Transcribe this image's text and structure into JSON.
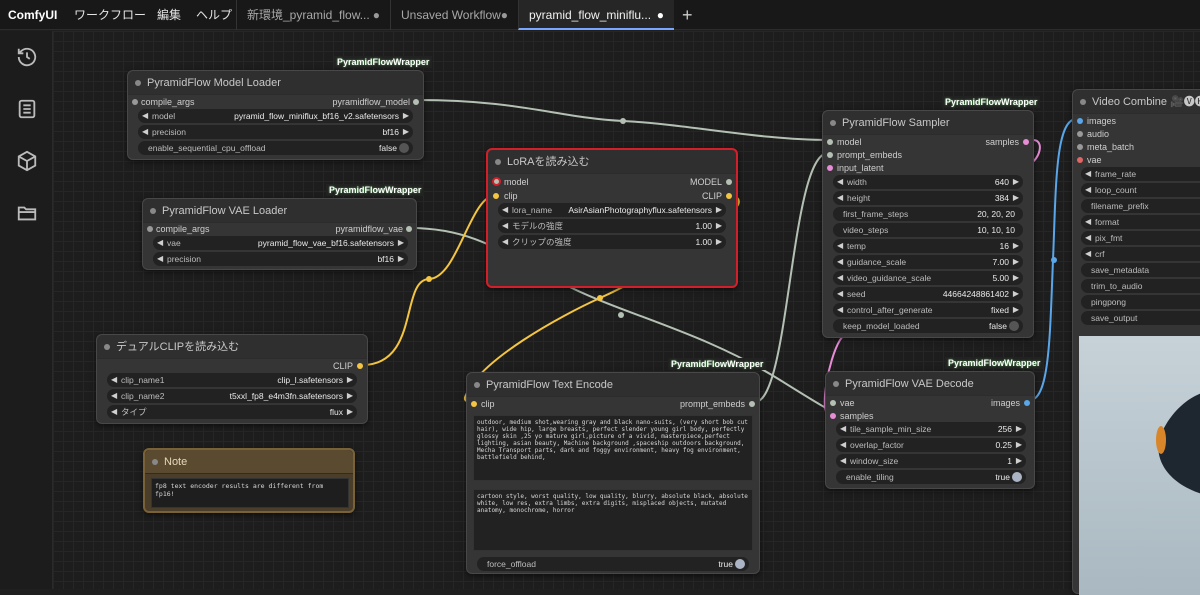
{
  "menu": {
    "logo": "ComfyUI",
    "items": [
      "ワークフロー",
      "編集",
      "ヘルプ"
    ]
  },
  "tabs": [
    {
      "label": "新環境_pyramid_flow...",
      "active": false
    },
    {
      "label": "Unsaved Workflow",
      "active": false
    },
    {
      "label": "pyramid_flow_miniflu...",
      "active": true
    }
  ],
  "add_tab_label": "+",
  "sidebar_icons": [
    "history-icon",
    "queue-list-icon",
    "model-cube-icon",
    "folder-icon"
  ],
  "colors": {
    "clip_wire": "#f4c542",
    "model_wire": "#b4c0b4",
    "latent_wire": "#e78cd6",
    "image_wire": "#5aa6e8",
    "lora_border": "#d21f2a"
  },
  "nodes": {
    "model_loader": {
      "badge": "PyramidFlowWrapper",
      "title": "PyramidFlow Model Loader",
      "inputs": [
        "compile_args"
      ],
      "outputs": [
        "pyramidflow_model"
      ],
      "widgets": [
        {
          "label": "model",
          "value": "pyramid_flow_miniflux_bf16_v2.safetensors"
        },
        {
          "label": "precision",
          "value": "bf16"
        },
        {
          "label": "enable_sequential_cpu_offload",
          "value": "false"
        }
      ]
    },
    "vae_loader": {
      "badge": "PyramidFlowWrapper",
      "title": "PyramidFlow VAE Loader",
      "inputs": [
        "compile_args"
      ],
      "outputs": [
        "pyramidflow_vae"
      ],
      "widgets": [
        {
          "label": "vae",
          "value": "pyramid_flow_vae_bf16.safetensors"
        },
        {
          "label": "precision",
          "value": "bf16"
        }
      ]
    },
    "lora": {
      "title": "LoRAを読み込む",
      "inputs": [
        "model",
        "clip"
      ],
      "outputs": [
        "MODEL",
        "CLIP"
      ],
      "widgets": [
        {
          "label": "lora_name",
          "value": "AsirAsianPhotographyflux.safetensors"
        },
        {
          "label": "モデルの強度",
          "value": "1.00"
        },
        {
          "label": "クリップの強度",
          "value": "1.00"
        }
      ]
    },
    "dual_clip": {
      "title": "デュアルCLIPを読み込む",
      "outputs": [
        "CLIP"
      ],
      "widgets": [
        {
          "label": "clip_name1",
          "value": "clip_l.safetensors"
        },
        {
          "label": "clip_name2",
          "value": "t5xxl_fp8_e4m3fn.safetensors"
        },
        {
          "label": "タイプ",
          "value": "flux"
        }
      ]
    },
    "note": {
      "title": "Note",
      "text": "fp8 text encoder results are different from fp16!"
    },
    "text_encode": {
      "badge": "PyramidFlowWrapper",
      "title": "PyramidFlow Text Encode",
      "inputs": [
        "clip"
      ],
      "outputs": [
        "prompt_embeds"
      ],
      "positive": "outdoor, medium shot,wearing gray and black nano-suits, (very short bob cut hair), wide hip, large breasts, perfect slender young girl body, perfectly glossy skin ,25 yo mature girl,picture of a vivid, masterpiece,perfect lighting, asian beauty, Machine background ,spaceship outdoors background, Mecha Transport parts, dark and foggy environment, heavy fog environment, battlefield behind,",
      "negative": "cartoon style, worst quality, low quality, blurry, absolute black, absolute white, low res, extra limbs, extra digits, misplaced objects, mutated anatomy, monochrome, horror",
      "widgets": [
        {
          "label": "force_offload",
          "value": "true"
        }
      ]
    },
    "sampler": {
      "badge": "PyramidFlowWrapper",
      "title": "PyramidFlow Sampler",
      "inputs": [
        "model",
        "prompt_embeds",
        "input_latent"
      ],
      "outputs": [
        "samples"
      ],
      "widgets": [
        {
          "label": "width",
          "value": "640"
        },
        {
          "label": "height",
          "value": "384"
        },
        {
          "label": "first_frame_steps",
          "value": "20, 20, 20"
        },
        {
          "label": "video_steps",
          "value": "10, 10, 10"
        },
        {
          "label": "temp",
          "value": "16"
        },
        {
          "label": "guidance_scale",
          "value": "7.00"
        },
        {
          "label": "video_guidance_scale",
          "value": "5.00"
        },
        {
          "label": "seed",
          "value": "446642488614​02"
        },
        {
          "label": "control_after_generate",
          "value": "fixed"
        },
        {
          "label": "keep_model_loaded",
          "value": "false"
        }
      ]
    },
    "vae_decode": {
      "badge": "PyramidFlowWrapper",
      "title": "PyramidFlow VAE Decode",
      "inputs": [
        "vae",
        "samples"
      ],
      "outputs": [
        "images"
      ],
      "widgets": [
        {
          "label": "tile_sample_min_size",
          "value": "256"
        },
        {
          "label": "overlap_factor",
          "value": "0.25"
        },
        {
          "label": "window_size",
          "value": "1"
        },
        {
          "label": "enable_tiling",
          "value": "true"
        }
      ]
    },
    "video_combine": {
      "title": "Video Combine 🎥🅥🅗🅢",
      "inputs": [
        "images",
        "audio",
        "meta_batch",
        "vae"
      ],
      "widgets": [
        "frame_rate",
        "loop_count",
        "filename_prefix",
        "format",
        "pix_fmt",
        "crf",
        "save_metadata",
        "trim_to_audio",
        "pingpong",
        "save_output"
      ]
    }
  }
}
